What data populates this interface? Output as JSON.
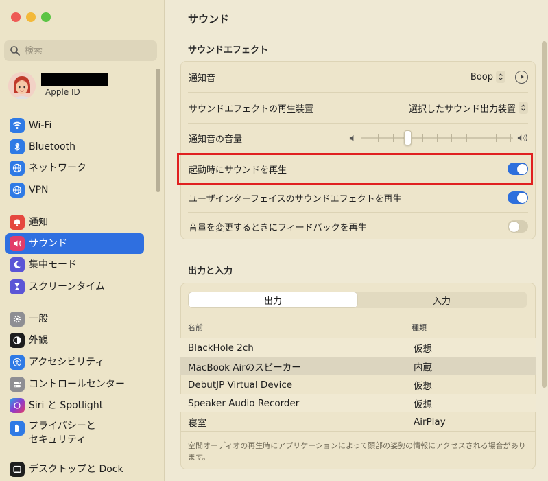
{
  "window": {
    "title": "サウンド"
  },
  "sidebar": {
    "search_placeholder": "検索",
    "account": {
      "subtitle": "Apple ID"
    },
    "items": [
      {
        "key": "wifi",
        "label": "Wi-Fi",
        "icon": "wifi-icon",
        "color": "#2f7ae5"
      },
      {
        "key": "bluetooth",
        "label": "Bluetooth",
        "icon": "bluetooth-icon",
        "color": "#2f7ae5"
      },
      {
        "key": "network",
        "label": "ネットワーク",
        "icon": "globe-icon",
        "color": "#2f7ae5"
      },
      {
        "key": "vpn",
        "label": "VPN",
        "icon": "globe-icon",
        "color": "#2f7ae5"
      },
      {
        "key": "notifications",
        "label": "通知",
        "icon": "bell-icon",
        "color": "#e5483f"
      },
      {
        "key": "sound",
        "label": "サウンド",
        "icon": "speaker-icon",
        "color": "#e23d6a",
        "active": true
      },
      {
        "key": "focus",
        "label": "集中モード",
        "icon": "moon-icon",
        "color": "#5b55d6"
      },
      {
        "key": "screentime",
        "label": "スクリーンタイム",
        "icon": "hourglass-icon",
        "color": "#5b55d6"
      },
      {
        "key": "general",
        "label": "一般",
        "icon": "gear-icon",
        "color": "#8e8e93"
      },
      {
        "key": "appearance",
        "label": "外観",
        "icon": "appearance-icon",
        "color": "#1e1e1e"
      },
      {
        "key": "accessibility",
        "label": "アクセシビリティ",
        "icon": "accessibility-icon",
        "color": "#2f7ae5"
      },
      {
        "key": "controlcenter",
        "label": "コントロールセンター",
        "icon": "toggles-icon",
        "color": "#8e8e93"
      },
      {
        "key": "siri",
        "label": "Siri と Spotlight",
        "icon": "siri-icon",
        "color": "#8a3ccf"
      },
      {
        "key": "privacy",
        "label": "プライバシーと\nセキュリティ",
        "label_line1": "プライバシーと",
        "label_line2": "セキュリティ",
        "icon": "hand-icon",
        "color": "#2f7ae5"
      },
      {
        "key": "desktop",
        "label": "デスクトップと Dock",
        "icon": "dock-icon",
        "color": "#1e1e1e"
      }
    ]
  },
  "sound_effects": {
    "section_title": "サウンドエフェクト",
    "alert_sound": {
      "label": "通知音",
      "value": "Boop"
    },
    "play_through": {
      "label": "サウンドエフェクトの再生装置",
      "value": "選択したサウンド出力装置"
    },
    "alert_volume": {
      "label": "通知音の音量",
      "level": 0.3
    },
    "startup_sound": {
      "label": "起動時にサウンドを再生",
      "on": true
    },
    "ui_sound_effects": {
      "label": "ユーザインターフェイスのサウンドエフェクトを再生",
      "on": true
    },
    "volume_feedback": {
      "label": "音量を変更するときにフィードバックを再生",
      "on": false
    }
  },
  "output_input": {
    "section_title": "出力と入力",
    "tabs": [
      {
        "label": "出力",
        "active": true
      },
      {
        "label": "入力",
        "active": false
      }
    ],
    "columns": {
      "name": "名前",
      "type": "種類"
    },
    "devices": [
      {
        "name": "BlackHole 2ch",
        "type": "仮想"
      },
      {
        "name": "MacBook Airのスピーカー",
        "type": "内蔵",
        "selected": true
      },
      {
        "name": "DebutJP Virtual Device",
        "type": "仮想"
      },
      {
        "name": "Speaker Audio Recorder",
        "type": "仮想"
      },
      {
        "name": "寝室",
        "type": "AirPlay"
      }
    ],
    "footnote": "空間オーディオの再生時にアプリケーションによって頭部の姿勢の情報にアクセスされる場合があります。"
  }
}
